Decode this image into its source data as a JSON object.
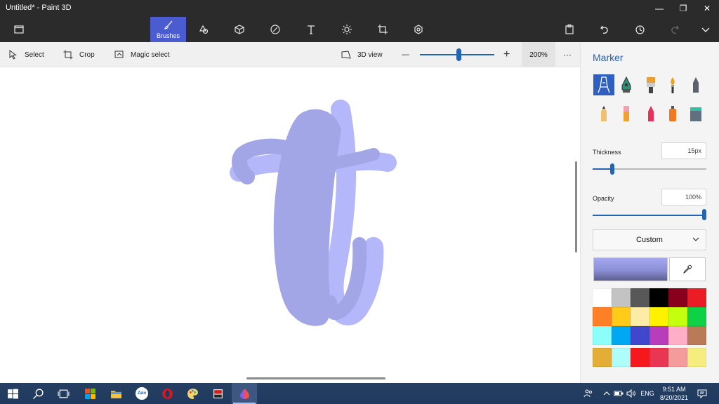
{
  "window": {
    "title": "Untitled* - Paint 3D",
    "minimize_glyph": "—",
    "maximize_glyph": "❐",
    "close_glyph": "✕"
  },
  "ribbon": {
    "active_tab_label": "Brushes",
    "icons": [
      "menu-folder-icon",
      "brushes-icon",
      "2d-shapes-icon",
      "3d-shapes-icon",
      "stickers-icon",
      "text-icon",
      "effects-icon",
      "canvas-icon",
      "3d-library-icon",
      "paste-icon",
      "undo-icon",
      "history-icon",
      "redo-icon",
      "expand-icon"
    ]
  },
  "toolbar": {
    "select_label": "Select",
    "crop_label": "Crop",
    "magic_select_label": "Magic select",
    "view3d_label": "3D view",
    "zoom_minus": "—",
    "zoom_plus": "+",
    "zoom_value": "200%",
    "more_label": "···"
  },
  "panel": {
    "title": "Marker",
    "tools": [
      "marker",
      "calligraphy-pen",
      "oil-brush",
      "watercolor",
      "pixel-pen",
      "pencil",
      "eraser",
      "crayon",
      "spray-can",
      "fill"
    ],
    "thickness_label": "Thickness",
    "thickness_value": "15px",
    "thickness_fraction": 0.16,
    "opacity_label": "Opacity",
    "opacity_value": "100%",
    "opacity_fraction": 1.0,
    "color_mode": "Custom",
    "current_color": "#a4a8f0",
    "palette": [
      "#ffffff",
      "#c3c3c3",
      "#585858",
      "#000000",
      "#88001b",
      "#ec1c24",
      "#ff7f27",
      "#ffca18",
      "#fdeca6",
      "#fff200",
      "#c4ff0e",
      "#0ed145",
      "#8cfffb",
      "#00a8f3",
      "#3f48cc",
      "#b83dba",
      "#ffaec8",
      "#b97a56",
      "#e3ad36",
      "#aefdfb",
      "#f5191d",
      "#e93753",
      "#f49b9b",
      "#f5ee7e"
    ]
  },
  "canvas": {
    "stroke_color_back": "#b4b8fb",
    "stroke_color_front": "#a2a6e6"
  },
  "taskbar": {
    "apps": [
      "windows-start-icon",
      "search-icon",
      "task-view-icon",
      "store-icon",
      "file-explorer-icon",
      "zalo-icon",
      "opera-icon",
      "paint-icon",
      "ms-paint-icon",
      "paint-3d-icon"
    ],
    "zalo_label": "Zalo",
    "language": "ENG",
    "time": "9:51 AM",
    "date": "8/20/2021"
  }
}
